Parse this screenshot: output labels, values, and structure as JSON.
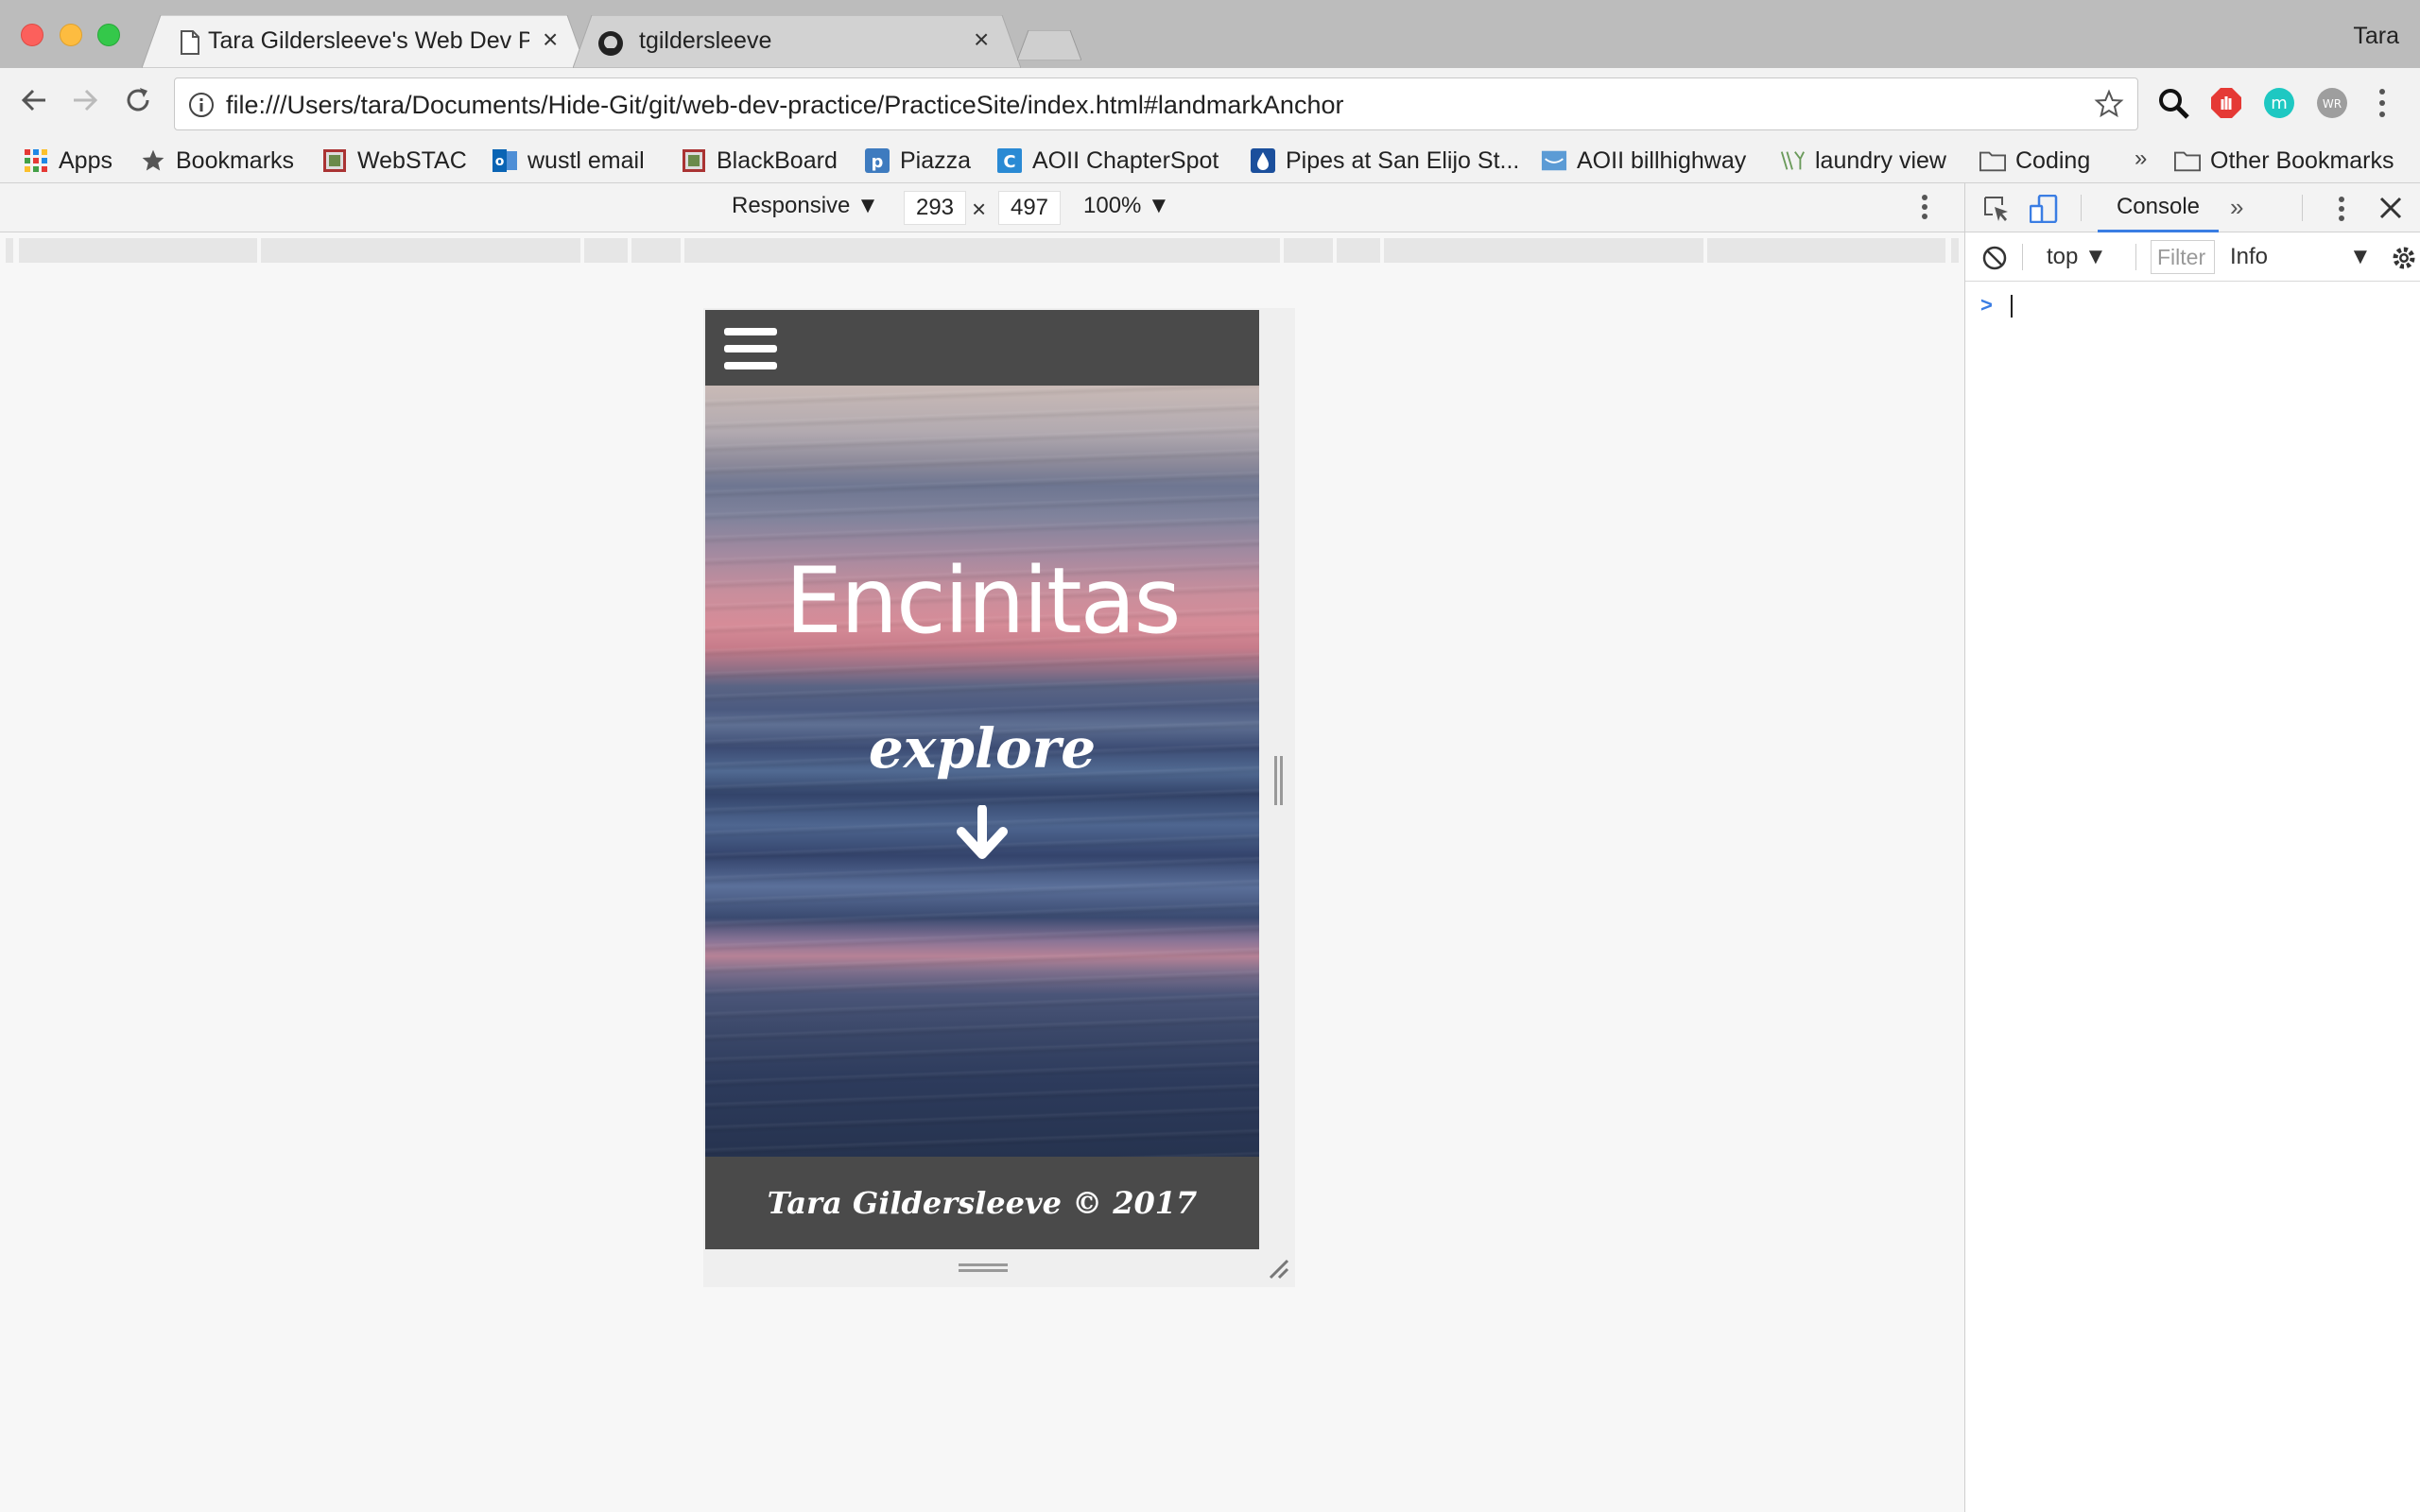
{
  "window": {
    "profile_name": "Tara",
    "tabs": [
      {
        "title": "Tara Gildersleeve's Web Dev P",
        "icon": "page-icon",
        "active": true
      },
      {
        "title": "tgildersleeve",
        "icon": "github-icon",
        "active": false
      }
    ]
  },
  "toolbar": {
    "url": "file:///Users/tara/Documents/Hide-Git/git/web-dev-practice/PracticeSite/index.html#landmarkAnchor",
    "extension_m_label": "m",
    "extension_wr_label": "WR"
  },
  "bookmarks": {
    "items": [
      {
        "label": "Apps",
        "icon": "apps-grid-icon"
      },
      {
        "label": "Bookmarks",
        "icon": "star-icon"
      },
      {
        "label": "WebSTAC",
        "icon": "crest-icon"
      },
      {
        "label": "wustl email",
        "icon": "outlook-icon"
      },
      {
        "label": "BlackBoard",
        "icon": "crest-icon"
      },
      {
        "label": "Piazza",
        "icon": "piazza-icon"
      },
      {
        "label": "AOII ChapterSpot",
        "icon": "chapterspot-icon"
      },
      {
        "label": "Pipes at San Elijo St...",
        "icon": "drop-icon"
      },
      {
        "label": "AOII billhighway",
        "icon": "billhighway-icon"
      },
      {
        "label": "laundry view",
        "icon": "laundry-icon"
      },
      {
        "label": "Coding",
        "icon": "folder-icon"
      }
    ],
    "more_label": "»",
    "other_label": "Other Bookmarks"
  },
  "device_toolbar": {
    "device": "Responsive",
    "width": "293",
    "height": "497",
    "zoom": "100%",
    "times": "×"
  },
  "site": {
    "hero_title": "Encinitas",
    "explore_label": "explore",
    "footer_text": "Tara Gildersleeve © 2017"
  },
  "devtools": {
    "active_tab": "Console",
    "more_tabs": "»",
    "context": "top",
    "filter_placeholder": "Filter",
    "level": "Info",
    "prompt": ">"
  },
  "colors": {
    "accent": "#3a7de3",
    "site_bar": "#4a4a4a"
  }
}
